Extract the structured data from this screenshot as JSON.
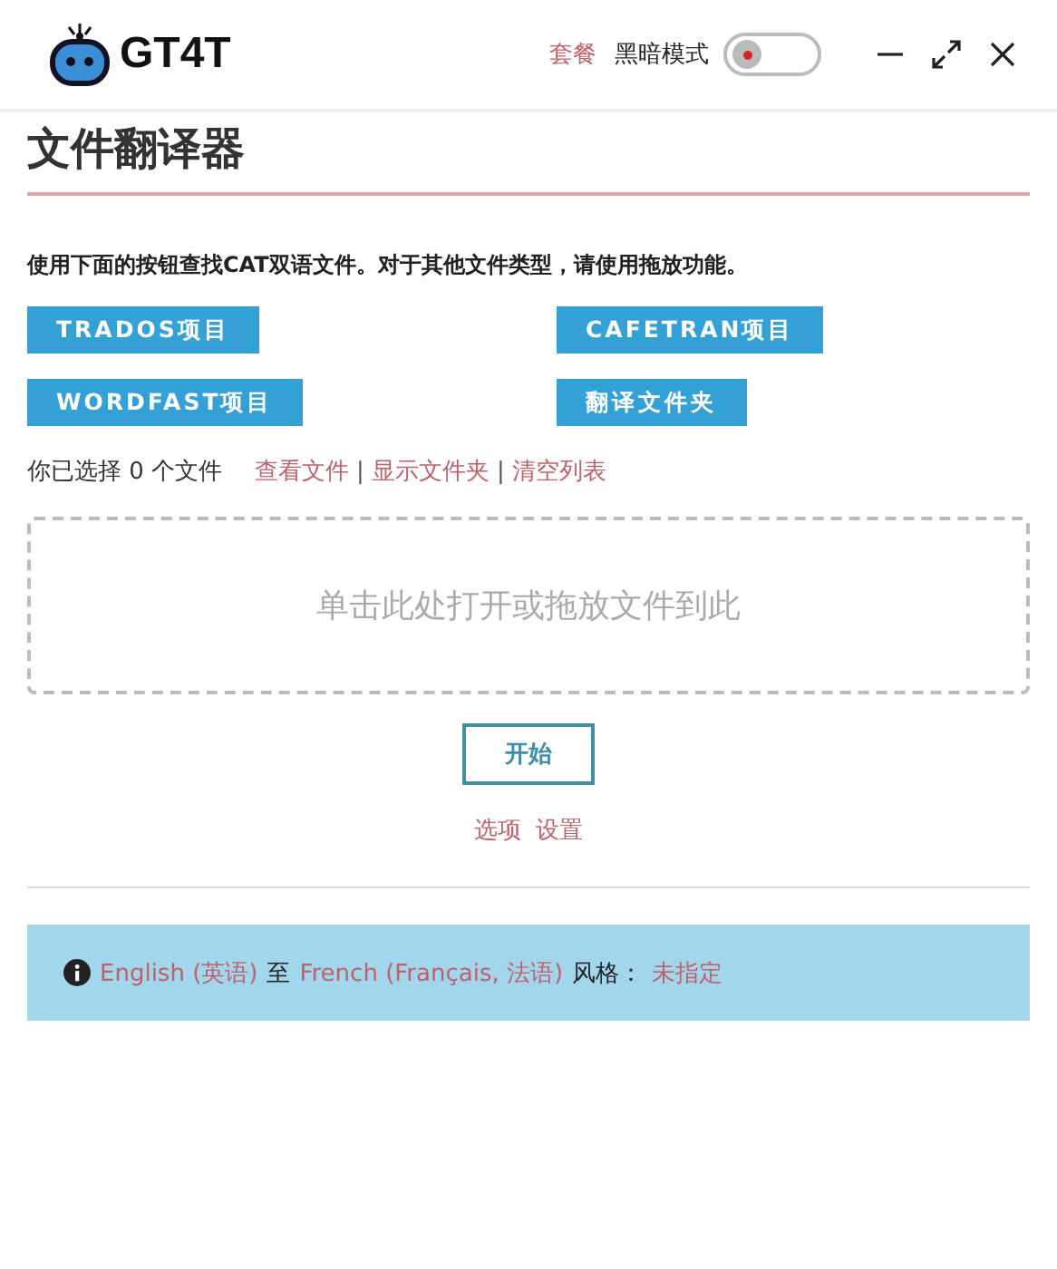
{
  "header": {
    "logo_text": "GT4T",
    "plan_link": "套餐",
    "dark_mode": {
      "label": "黑暗模式",
      "on": false
    }
  },
  "title": "文件翻译器",
  "instruction": "使用下面的按钮查找CAT双语文件。对于其他文件类型，请使用拖放功能。",
  "project_buttons": [
    "TRADOS项目",
    "CAFETRAN项目",
    "WORDFAST项目",
    "翻译文件夹"
  ],
  "selection": {
    "count_text": "你已选择 0 个文件",
    "items": [
      {
        "kind": "link",
        "text": "查看文件"
      },
      {
        "kind": "separator",
        "text": "|"
      },
      {
        "kind": "link",
        "text": "显示文件夹"
      },
      {
        "kind": "separator",
        "text": "|"
      },
      {
        "kind": "link",
        "text": "清空列表"
      }
    ]
  },
  "drop_zone": {
    "text": "单击此处打开或拖放文件到此"
  },
  "start_button": "开始",
  "option_links": [
    "选项",
    "设置"
  ],
  "info_bar": [
    {
      "kind": "link",
      "text": "English (英语)"
    },
    {
      "kind": "text",
      "text": "至"
    },
    {
      "kind": "link",
      "text": "French (Français, 法语)"
    },
    {
      "kind": "text",
      "text": "风格："
    },
    {
      "kind": "link",
      "text": "未指定"
    }
  ]
}
